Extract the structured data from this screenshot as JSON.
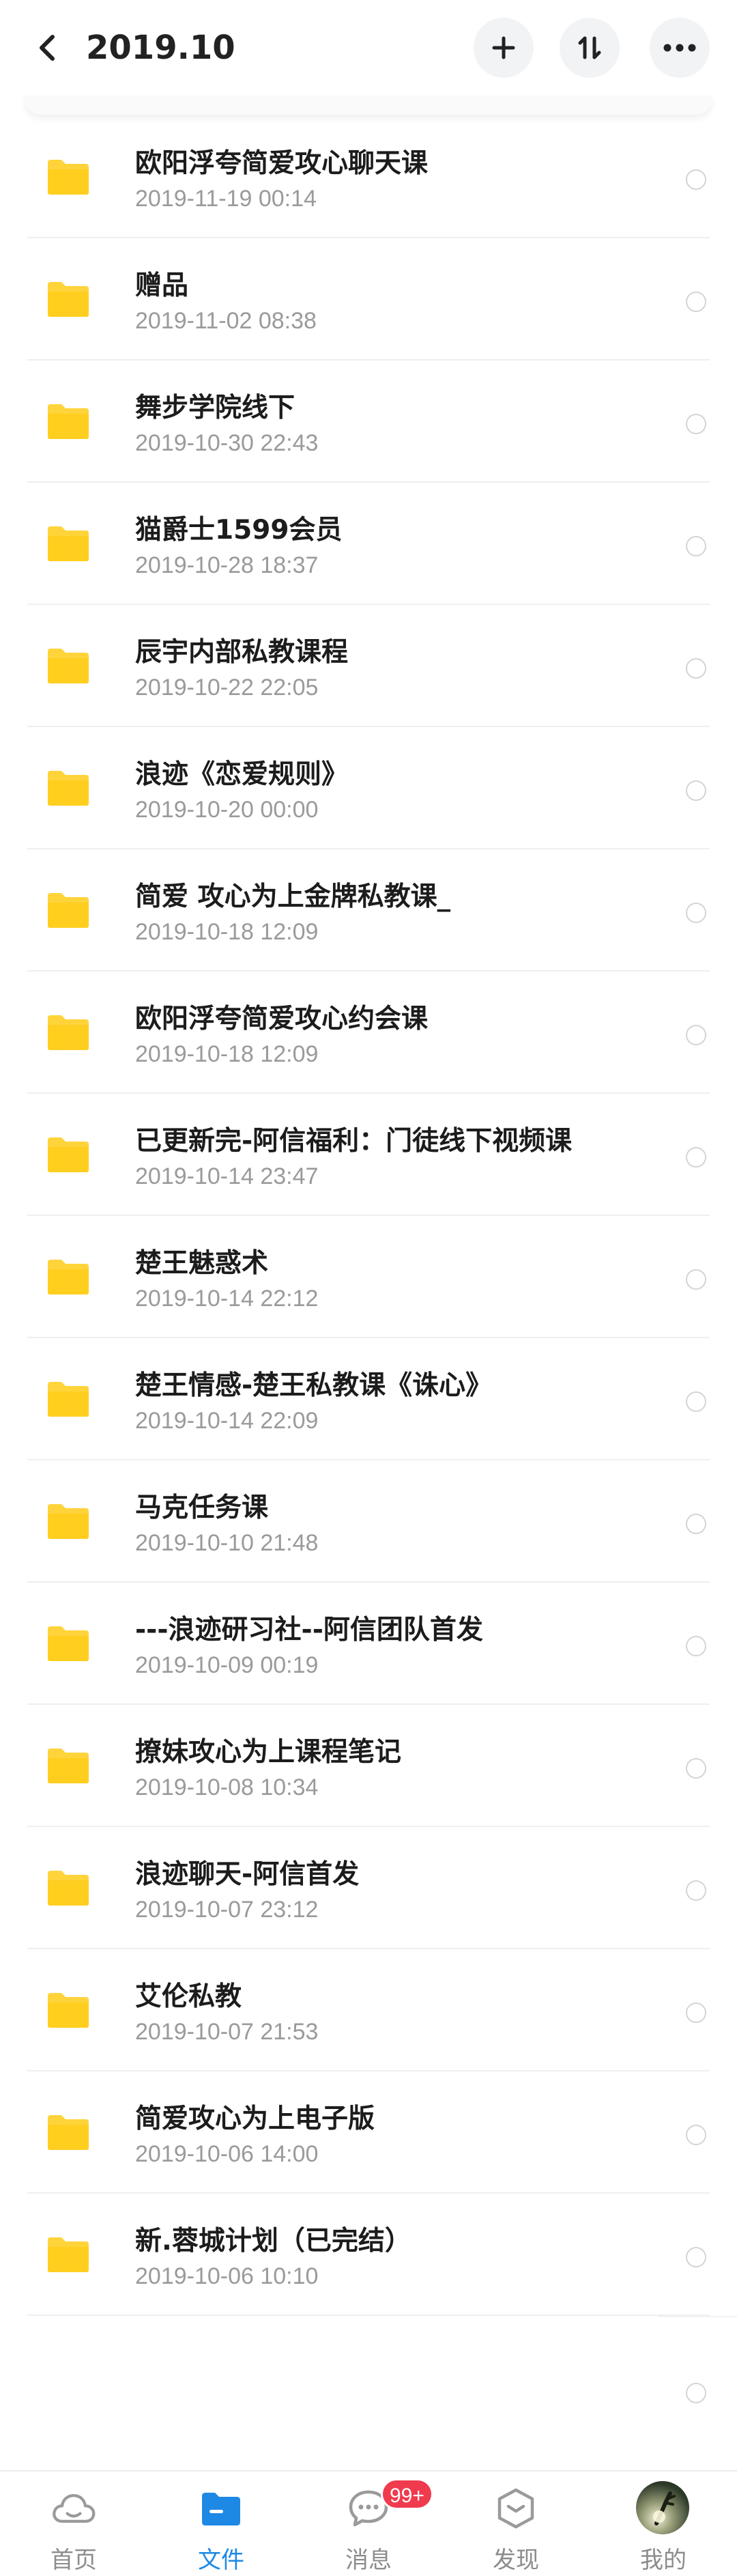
{
  "header": {
    "title": "2019.10",
    "back_icon": "chevron-left-icon",
    "add_icon": "plus-icon",
    "sort_icon": "sort-icon",
    "more_icon": "more-horizontal-icon"
  },
  "files": [
    {
      "name": "欧阳浮夸简爱攻心聊天课",
      "date": "2019-11-19  00:14"
    },
    {
      "name": "赠品",
      "date": "2019-11-02  08:38"
    },
    {
      "name": "舞步学院线下",
      "date": "2019-10-30  22:43"
    },
    {
      "name": "猫爵士1599会员",
      "date": "2019-10-28  18:37"
    },
    {
      "name": "辰宇内部私教课程",
      "date": "2019-10-22  22:05"
    },
    {
      "name": "浪迹《恋爱规则》",
      "date": "2019-10-20  00:00"
    },
    {
      "name": "简爱 攻心为上金牌私教课_",
      "date": "2019-10-18  12:09"
    },
    {
      "name": "欧阳浮夸简爱攻心约会课",
      "date": "2019-10-18  12:09"
    },
    {
      "name": "已更新完-阿信福利：门徒线下视频课",
      "date": "2019-10-14  23:47"
    },
    {
      "name": "楚王魅惑术",
      "date": "2019-10-14  22:12"
    },
    {
      "name": "楚王情感-楚王私教课《诛心》",
      "date": "2019-10-14  22:09"
    },
    {
      "name": "马克任务课",
      "date": "2019-10-10  21:48"
    },
    {
      "name": "---浪迹研习社--阿信团队首发",
      "date": "2019-10-09  00:19"
    },
    {
      "name": "撩妹攻心为上课程笔记",
      "date": "2019-10-08  10:34"
    },
    {
      "name": "浪迹聊天-阿信首发",
      "date": "2019-10-07  23:12"
    },
    {
      "name": "艾伦私教",
      "date": "2019-10-07  21:53"
    },
    {
      "name": "简爱攻心为上电子版",
      "date": "2019-10-06  14:00"
    },
    {
      "name": "新.蓉城计划（已完结）",
      "date": "2019-10-06  10:10"
    }
  ],
  "colors": {
    "folder": "#ffd43b",
    "accent": "#1e88e5",
    "badge": "#f03b4e"
  },
  "bottom_nav": {
    "home": {
      "label": "首页",
      "icon": "cloud-icon"
    },
    "files": {
      "label": "文件",
      "icon": "folder-icon"
    },
    "messages": {
      "label": "消息",
      "icon": "chat-bubble-icon",
      "badge": "99+"
    },
    "discover": {
      "label": "发现",
      "icon": "hexagon-icon"
    },
    "me": {
      "label": "我的",
      "icon": "avatar-icon"
    }
  }
}
